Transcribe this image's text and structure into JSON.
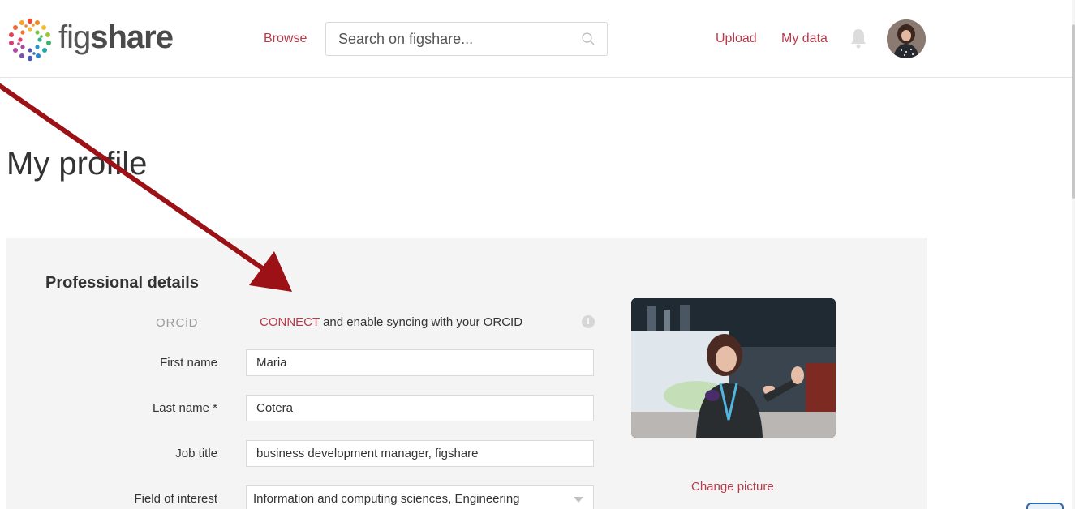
{
  "header": {
    "logo": {
      "prefix": "fig",
      "suffix": "share"
    },
    "browse_label": "Browse",
    "search_placeholder": "Search on figshare...",
    "upload_label": "Upload",
    "mydata_label": "My data",
    "icons": {
      "search": "search-icon",
      "bell": "bell-icon"
    }
  },
  "page": {
    "title": "My profile"
  },
  "professional": {
    "section_title": "Professional details",
    "orcid": {
      "label": "ORCiD",
      "connect_link": "CONNECT",
      "connect_text": " and enable syncing with your ORCID",
      "info_glyph": "i"
    },
    "fields": {
      "first_name": {
        "label": "First name",
        "value": "Maria"
      },
      "last_name": {
        "label": "Last name *",
        "value": "Cotera"
      },
      "job_title": {
        "label": "Job title",
        "value": "business development manager, figshare"
      },
      "field_of_interest": {
        "label": "Field of interest",
        "value": "Information and computing sciences, Engineering"
      }
    },
    "change_picture": "Change picture"
  },
  "colors": {
    "accent": "#b8394a",
    "panel_bg": "#f4f4f4",
    "arrow": "#9b1116"
  }
}
